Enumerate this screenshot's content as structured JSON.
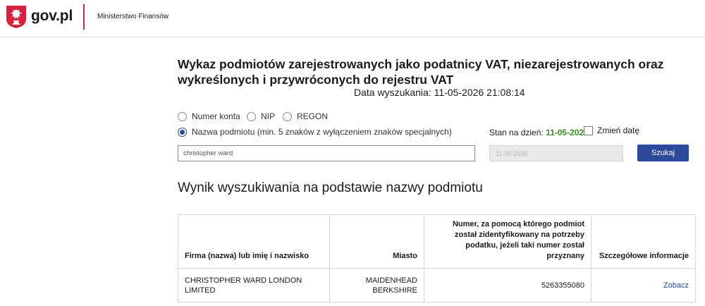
{
  "header": {
    "site_name": "gov.pl",
    "ministry": "Ministerstwo Finansów",
    "colors": {
      "divider": "#d5233f",
      "emblem_red": "#d5233f"
    }
  },
  "page": {
    "title": "Wykaz podmiotów zarejestrowanych jako podatnicy VAT, niezarejestrowanych oraz wykreślonych i przywróconych do rejestru VAT",
    "search_date": "Data wyszukania: 11-05-2026 21:08:14"
  },
  "search": {
    "options": [
      {
        "label": "Numer konta",
        "checked": false
      },
      {
        "label": "NIP",
        "checked": false
      },
      {
        "label": "REGON",
        "checked": false
      },
      {
        "label": "Nazwa podmiotu (min. 5 znaków z wyłączeniem znaków specjalnych)",
        "checked": true
      }
    ],
    "stan_label": "Stan na dzień:",
    "stan_date": "11-05-2026",
    "change_date_label": "Zmień datę",
    "change_date_checked": false,
    "query_value": "christopher ward",
    "date_value": "11-05-2026",
    "button_label": "Szukaj",
    "colors": {
      "accent": "#2d4a9a",
      "date_green": "#3a8a1f"
    }
  },
  "results": {
    "heading": "Wynik wyszukiwania na podstawie nazwy podmiotu",
    "columns": [
      "Firma (nazwa) lub imię i nazwisko",
      "Miasto",
      "Numer, za pomocą którego podmiot został zidentyfikowany na potrzeby podatku, jeżeli taki numer został przyznany",
      "Szczegółowe informacje"
    ],
    "rows": [
      {
        "name": "CHRISTOPHER WARD LONDON LIMITED",
        "city": "MAIDENHEAD BERKSHIRE",
        "number": "5263355080",
        "details": "Zobacz"
      }
    ]
  }
}
